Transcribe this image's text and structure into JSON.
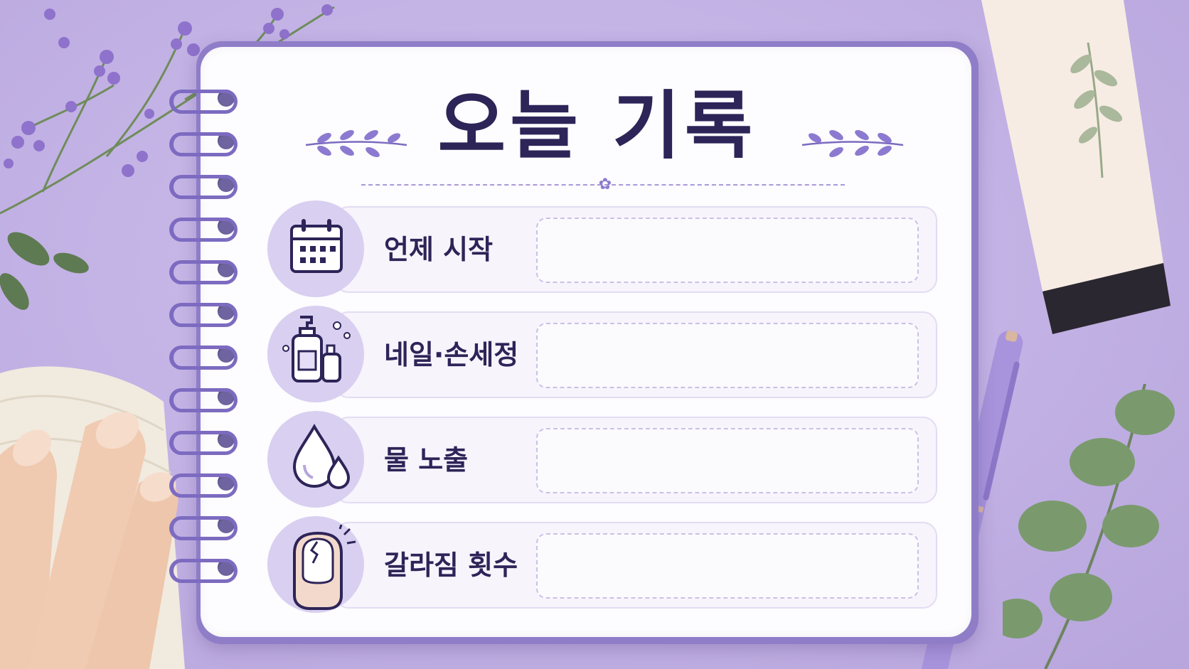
{
  "title": "오늘 기록",
  "colors": {
    "background": "#c2b1e4",
    "notebook_cover": "#8f7dc8",
    "page": "#fdfcfe",
    "ink": "#2d2458",
    "accent": "#7c6bc0",
    "icon_circle": "#d9cff0"
  },
  "rows": [
    {
      "label": "언제 시작",
      "icon": "calendar-icon",
      "value": ""
    },
    {
      "label": "네일·손세정",
      "icon": "soap-bottles-icon",
      "value": ""
    },
    {
      "label": "물 노출",
      "icon": "water-drop-icon",
      "value": ""
    },
    {
      "label": "갈라짐 횟수",
      "icon": "cracked-nail-icon",
      "value": ""
    }
  ]
}
